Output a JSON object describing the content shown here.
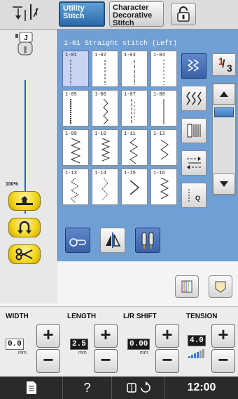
{
  "topbar": {
    "tabs": [
      {
        "label_line1": "Utility",
        "label_line2": "Stitch",
        "active": true
      },
      {
        "label_line1": "Character",
        "label_line2": "Decorative",
        "label_line3": "Stitch",
        "active": false
      }
    ],
    "lock_icon": "unlock-icon"
  },
  "left": {
    "presser_foot": "J",
    "speed_percent": "100%"
  },
  "panel": {
    "selected_title": "1-01  Straight stitch (Left)",
    "page_current": "1",
    "page_total": "3",
    "stitches": [
      "1-01",
      "1-02",
      "1-03",
      "1-04",
      "1-05",
      "1-06",
      "1-07",
      "1-08",
      "1-09",
      "1-10",
      "1-11",
      "1-12",
      "1-13",
      "1-14",
      "1-15",
      "1-16"
    ],
    "selected_index": 0
  },
  "settings": {
    "width": {
      "label": "WIDTH",
      "value": "0.0",
      "unit": "mm"
    },
    "length": {
      "label": "LENGTH",
      "value": "2.5",
      "unit": "mm"
    },
    "lr_shift": {
      "label": "L/R SHIFT",
      "value": "0.00",
      "unit": "mm"
    },
    "tension": {
      "label": "TENSION",
      "value": "4.0"
    }
  },
  "bottombar": {
    "help": "?",
    "clock": "12:00"
  },
  "colors": {
    "panel_blue": "#6f9fd4",
    "active_tab": "#2b6aa9",
    "yellow_button": "#f2d51a",
    "stitch_line": "#2b57c7",
    "page_current": "#d30000"
  }
}
